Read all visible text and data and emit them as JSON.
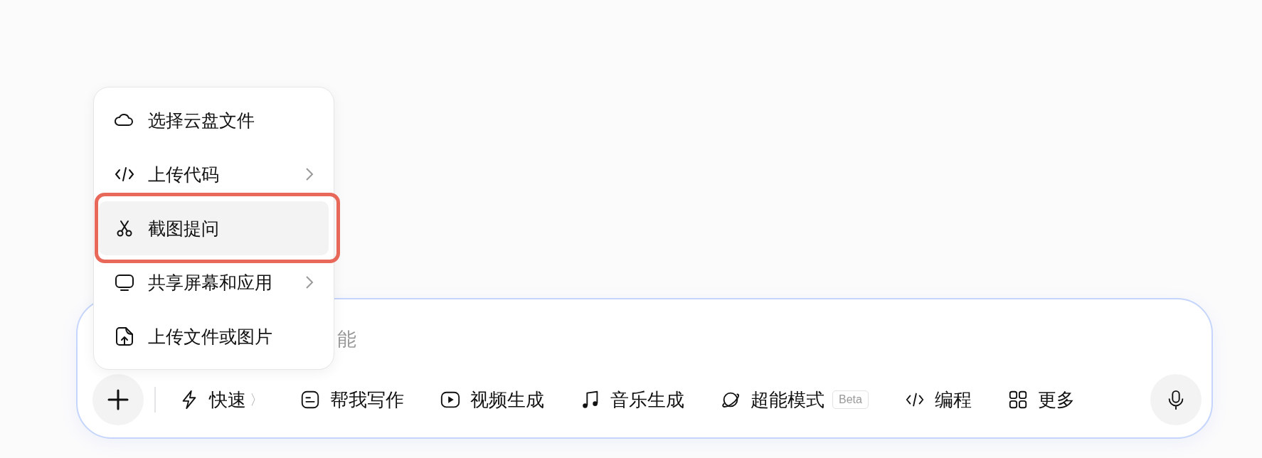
{
  "menu": {
    "items": [
      {
        "label": "选择云盘文件",
        "submenu": false,
        "selected": false
      },
      {
        "label": "上传代码",
        "submenu": true,
        "selected": false
      },
      {
        "label": "截图提问",
        "submenu": false,
        "selected": true
      },
      {
        "label": "共享屏幕和应用",
        "submenu": true,
        "selected": false
      },
      {
        "label": "上传文件或图片",
        "submenu": false,
        "selected": false
      }
    ]
  },
  "composer": {
    "placeholder": "能",
    "tools": [
      {
        "label": "快速",
        "chevron": "〉"
      },
      {
        "label": "帮我写作"
      },
      {
        "label": "视频生成"
      },
      {
        "label": "音乐生成"
      },
      {
        "label": "超能模式",
        "badge": "Beta"
      },
      {
        "label": "编程"
      },
      {
        "label": "更多"
      }
    ]
  }
}
